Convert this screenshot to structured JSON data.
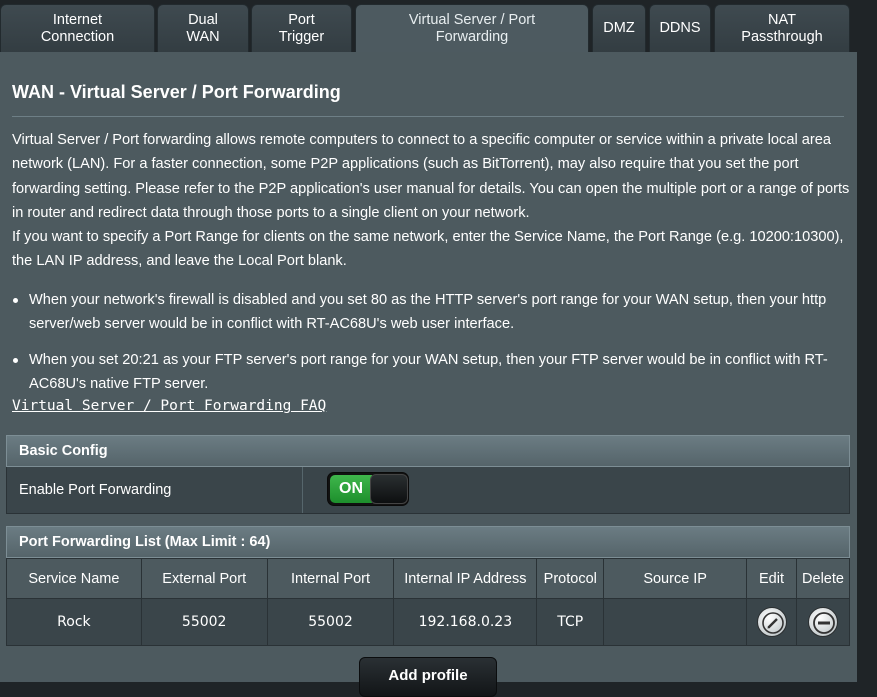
{
  "tabs": [
    {
      "line1": "Internet",
      "line2": "Connection"
    },
    {
      "line1": "Dual",
      "line2": "WAN"
    },
    {
      "line1": "Port",
      "line2": "Trigger"
    },
    {
      "line1": "Virtual Server / Port",
      "line2": "Forwarding"
    },
    {
      "line1": "DMZ",
      "line2": ""
    },
    {
      "line1": "DDNS",
      "line2": ""
    },
    {
      "line1": "NAT",
      "line2": "Passthrough"
    }
  ],
  "page": {
    "title": "WAN - Virtual Server / Port Forwarding",
    "description1": "Virtual Server / Port forwarding allows remote computers to connect to a specific computer or service within a private local area network (LAN). For a faster connection, some P2P applications (such as BitTorrent), may also require that you set the port forwarding setting. Please refer to the P2P application's user manual for details. You can open the multiple port or a range of ports in router and redirect data through those ports to a single client on your network.",
    "description2": "If you want to specify a Port Range for clients on the same network, enter the Service Name, the Port Range (e.g. 10200:10300), the LAN IP address, and leave the Local Port blank.",
    "bullets": [
      "When your network's firewall is disabled and you set 80 as the HTTP server's port range for your WAN setup, then your http server/web server would be in conflict with RT-AC68U's web user interface.",
      "When you set 20:21 as your FTP server's port range for your WAN setup, then your FTP server would be in conflict with RT-AC68U's native FTP server."
    ],
    "faq_link": "Virtual Server / Port Forwarding FAQ"
  },
  "basic_config": {
    "header": "Basic Config",
    "enable_label": "Enable Port Forwarding",
    "toggle_label": "ON"
  },
  "list": {
    "header": "Port Forwarding List (Max Limit : 64)",
    "columns": [
      "Service Name",
      "External Port",
      "Internal Port",
      "Internal IP Address",
      "Protocol",
      "Source IP",
      "Edit",
      "Delete"
    ],
    "rows": [
      {
        "service": "Rock",
        "external": "55002",
        "internal": "55002",
        "ip": "192.168.0.23",
        "protocol": "TCP",
        "source": ""
      }
    ]
  },
  "add_button": "Add profile"
}
